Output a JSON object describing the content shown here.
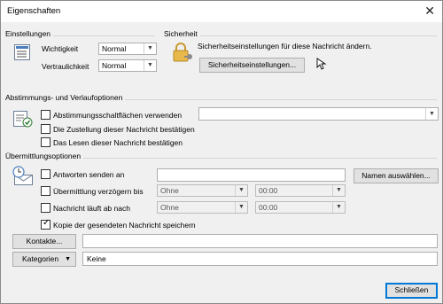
{
  "window": {
    "title": "Eigenschaften"
  },
  "settings": {
    "heading": "Einstellungen",
    "importance_label": "Wichtigkeit",
    "importance_value": "Normal",
    "sensitivity_label": "Vertraulichkeit",
    "sensitivity_value": "Normal"
  },
  "security": {
    "heading": "Sicherheit",
    "text": "Sicherheitseinstellungen für diese Nachricht ändern.",
    "button": "Sicherheitseinstellungen..."
  },
  "voting": {
    "heading": "Abstimmungs- und Verlaufoptionen",
    "use_voting": "Abstimmungsschaltflächen verwenden",
    "delivery_receipt": "Die Zustellung dieser Nachricht bestätigen",
    "read_receipt": "Das Lesen dieser Nachricht bestätigen"
  },
  "delivery": {
    "heading": "Übermittlungsoptionen",
    "replies_to": "Antworten senden an",
    "select_names": "Namen auswählen...",
    "delay_label": "Übermittlung verzögern bis",
    "delay_date": "Ohne",
    "delay_time": "00:00",
    "expires_label": "Nachricht läuft ab nach",
    "expires_date": "Ohne",
    "expires_time": "00:00",
    "save_copy": "Kopie der gesendeten Nachricht speichern"
  },
  "contacts": {
    "button": "Kontakte...",
    "value": ""
  },
  "categories": {
    "button": "Kategorien",
    "value": "Keine"
  },
  "footer": {
    "close": "Schließen"
  }
}
